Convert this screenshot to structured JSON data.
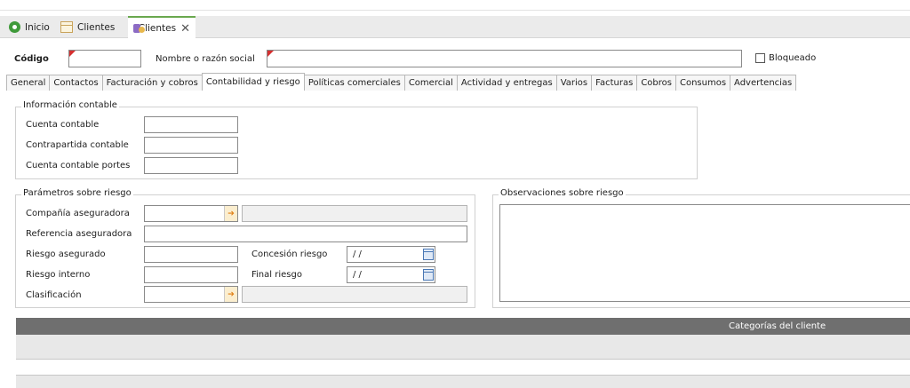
{
  "doc_tabs": [
    {
      "label": "Inicio",
      "icon": "home-icon"
    },
    {
      "label": "Clientes",
      "icon": "grid-icon"
    },
    {
      "label": "Clientes",
      "icon": "user-icon",
      "close": "✕"
    }
  ],
  "header": {
    "codigo_label": "Código",
    "codigo_value": "",
    "nombre_label": "Nombre o razón social",
    "nombre_value": "",
    "bloqueado_label": "Bloqueado",
    "bloqueado_checked": false
  },
  "sub_tabs": [
    "General",
    "Contactos",
    "Facturación y cobros",
    "Contabilidad y riesgo",
    "Políticas comerciales",
    "Comercial",
    "Actividad y entregas",
    "Varios",
    "Facturas",
    "Cobros",
    "Consumos",
    "Advertencias"
  ],
  "active_sub_tab": "Contabilidad y riesgo",
  "info_contable": {
    "title": "Información contable",
    "cuenta_contable": "Cuenta contable",
    "contrapartida": "Contrapartida contable",
    "cuenta_portes": "Cuenta contable portes"
  },
  "riesgo": {
    "title": "Parámetros sobre riesgo",
    "compania": "Compañía aseguradora",
    "referencia": "Referencia aseguradora",
    "riesgo_asegurado": "Riesgo asegurado",
    "riesgo_interno": "Riesgo interno",
    "clasificacion": "Clasificación",
    "concesion": "Concesión riesgo",
    "concesion_value": "/ /",
    "final": "Final riesgo",
    "final_value": "/ /"
  },
  "observaciones": {
    "title": "Observaciones sobre riesgo"
  },
  "grid": {
    "header": "Categorías del cliente"
  },
  "colors": {
    "accent_green": "#6aa84f",
    "required_marker": "#d63030",
    "lookup_orange": "#e07d10",
    "grid_header": "#6f6f6f"
  }
}
